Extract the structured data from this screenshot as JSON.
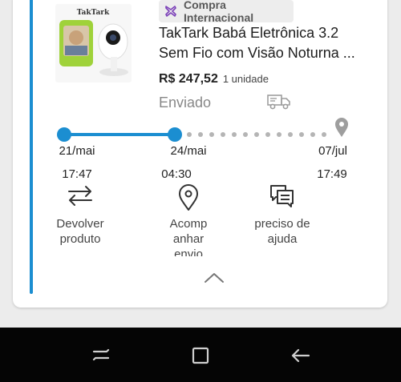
{
  "order": {
    "brand": "TakTark",
    "badge": "Compra Internacional",
    "title_line1": "TakTark Babá Eletrônica 3.2",
    "title_line2": "Sem Fio com Visão Noturna ...",
    "price": "R$ 247,52",
    "quantity": "1 unidade",
    "status": "Enviado"
  },
  "timeline": [
    {
      "date": "21/mai",
      "time": "17:47"
    },
    {
      "date": "24/mai",
      "time": "04:30"
    },
    {
      "date": "07/jul",
      "time": "17:49"
    }
  ],
  "actions": [
    {
      "label_1": "Devolver",
      "label_2": "produto",
      "icon": "swap-arrows-icon"
    },
    {
      "label_1": "Acomp",
      "label_2": "anhar",
      "label_3": "envio",
      "icon": "location-pin-icon"
    },
    {
      "label_1": "preciso de",
      "label_2": "ajuda",
      "icon": "chat-icon"
    }
  ],
  "colors": {
    "accent": "#1b8ed1",
    "muted": "#9e9e9e",
    "badge_icon": "#7a3fb8"
  }
}
